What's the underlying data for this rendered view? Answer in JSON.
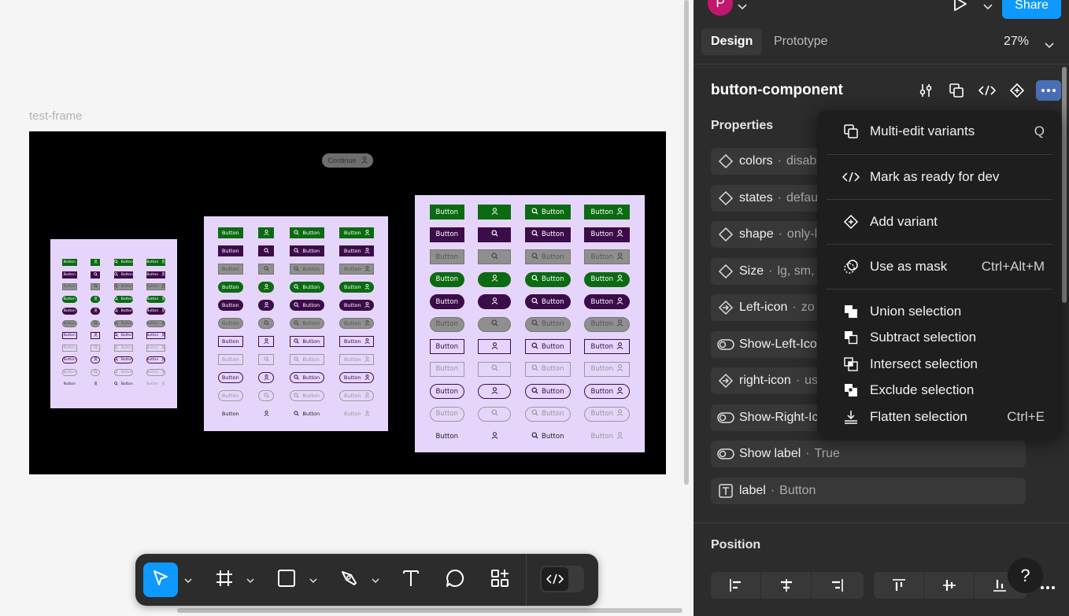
{
  "canvas": {
    "frame_label": "test-frame",
    "continue_chip": "Continue",
    "button_label": "Button"
  },
  "header": {
    "avatar_initial": "P",
    "share_label": "Share"
  },
  "tabs": [
    {
      "label": "Design",
      "active": true
    },
    {
      "label": "Prototype",
      "active": false
    }
  ],
  "zoom_level": "27%",
  "component": {
    "name": "button-component",
    "properties_title": "Properties",
    "properties": [
      {
        "icon": "variant-diamond-icon",
        "name": "colors",
        "value": "disab"
      },
      {
        "icon": "variant-diamond-icon",
        "name": "states",
        "value": "defau"
      },
      {
        "icon": "variant-diamond-icon",
        "name": "shape",
        "value": "only-l"
      },
      {
        "icon": "variant-diamond-icon",
        "name": "Size",
        "value": "lg, sm, r"
      },
      {
        "icon": "instance-swap-icon",
        "name": "Left-icon",
        "value": "zo"
      },
      {
        "icon": "boolean-toggle-icon",
        "name": "Show-Left-Ico",
        "value": ""
      },
      {
        "icon": "instance-swap-icon",
        "name": "right-icon",
        "value": "us"
      },
      {
        "icon": "boolean-toggle-icon",
        "name": "Show-Right-Ic",
        "value": ""
      },
      {
        "icon": "boolean-toggle-icon",
        "name": "Show label",
        "value": "True"
      },
      {
        "icon": "text-property-icon",
        "name": "label",
        "value": "Button"
      }
    ],
    "separator": "·"
  },
  "position": {
    "title": "Position"
  },
  "help_label": "?",
  "context_menu": {
    "items": [
      {
        "label": "Multi-edit variants",
        "shortcut": "Q",
        "icon": "multi-edit-icon"
      },
      {
        "label": "Mark as ready for dev",
        "shortcut": "",
        "icon": "code-icon"
      },
      {
        "label": "Add variant",
        "shortcut": "",
        "icon": "add-variant-icon"
      },
      {
        "label": "Use as mask",
        "shortcut": "Ctrl+Alt+M",
        "icon": "mask-icon"
      },
      {
        "label": "Union selection",
        "shortcut": "",
        "icon": "union-icon"
      },
      {
        "label": "Subtract selection",
        "shortcut": "",
        "icon": "subtract-icon"
      },
      {
        "label": "Intersect selection",
        "shortcut": "",
        "icon": "intersect-icon"
      },
      {
        "label": "Exclude selection",
        "shortcut": "",
        "icon": "exclude-icon"
      },
      {
        "label": "Flatten selection",
        "shortcut": "Ctrl+E",
        "icon": "flatten-icon"
      }
    ]
  },
  "colors": {
    "accent": "#0d99ff",
    "panel_bg": "#2c2c2c",
    "menu_bg": "#1e1e1e",
    "variant_bg": "#e6d5fb",
    "btn_green": "#0b6b12",
    "btn_purple": "#3b0c49",
    "btn_gray": "#8f8f8f"
  }
}
